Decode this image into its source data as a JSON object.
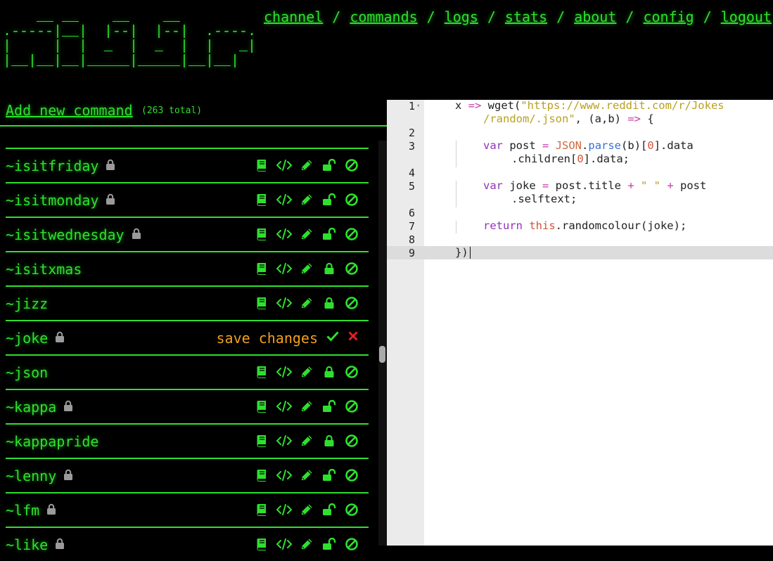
{
  "nav": {
    "items": [
      "channel",
      "commands",
      "logs",
      "stats",
      "about",
      "config",
      "logout"
    ],
    "separator": "/"
  },
  "logo": {
    "ascii": "    __ __    __    __\n.-----|__|  |--|  |--|  .----.\n|     |  |  _  |  _  |  |   _|\n|__|__|__|_____|_____|__|__|"
  },
  "commands_panel": {
    "add_label": "Add new command",
    "total_label": "(263 total)"
  },
  "commands": [
    {
      "name": "~isitfriday",
      "locked": true,
      "lock_state": "open"
    },
    {
      "name": "~isitmonday",
      "locked": true,
      "lock_state": "open"
    },
    {
      "name": "~isitwednesday",
      "locked": true,
      "lock_state": "open"
    },
    {
      "name": "~isitxmas",
      "locked": false,
      "lock_state": "closed"
    },
    {
      "name": "~jizz",
      "locked": false,
      "lock_state": "closed"
    },
    {
      "name": "~joke",
      "locked": true,
      "editing": true
    },
    {
      "name": "~json",
      "locked": false,
      "lock_state": "closed"
    },
    {
      "name": "~kappa",
      "locked": true,
      "lock_state": "open"
    },
    {
      "name": "~kappapride",
      "locked": false,
      "lock_state": "closed"
    },
    {
      "name": "~lenny",
      "locked": true,
      "lock_state": "open"
    },
    {
      "name": "~lfm",
      "locked": true,
      "lock_state": "open"
    },
    {
      "name": "~like",
      "locked": true,
      "lock_state": "open"
    }
  ],
  "edit_actions": {
    "save_label": "save changes"
  },
  "editor": {
    "line_numbers": [
      "1",
      "2",
      "3",
      "4",
      "5",
      "6",
      "7",
      "8",
      "9"
    ],
    "code": {
      "l1_a": "x ",
      "l1_arrow": "=>",
      "l1_b": " wget(",
      "l1_str1": "\"https://www.reddit.com/r/Jokes",
      "l1_str2": "/random/.json\"",
      "l1_c": ", (a,b) ",
      "l1_arrow2": "=>",
      "l1_d": " {",
      "l3_var": "var",
      "l3_a": " post ",
      "l3_eq": "=",
      "l3_json": "JSON",
      "l3_dot": ".",
      "l3_parse": "parse",
      "l3_b": "(b)[",
      "l3_zero": "0",
      "l3_c": "].data",
      "l3_d": ".children[",
      "l3_zero2": "0",
      "l3_e": "].data;",
      "l5_var": "var",
      "l5_a": " joke ",
      "l5_eq": "=",
      "l5_b": " post.title ",
      "l5_plus": "+",
      "l5_str": " \" \" ",
      "l5_plus2": "+",
      "l5_c": " post",
      "l5_d": ".selftext;",
      "l7_return": "return",
      "l7_this": "this",
      "l7_a": ".randomcolour(joke);",
      "l9": "})"
    }
  },
  "colors": {
    "accent": "#2ee02e",
    "save": "#f0a020",
    "cancel": "#e02020",
    "lock_grey": "#9a9a9a"
  }
}
